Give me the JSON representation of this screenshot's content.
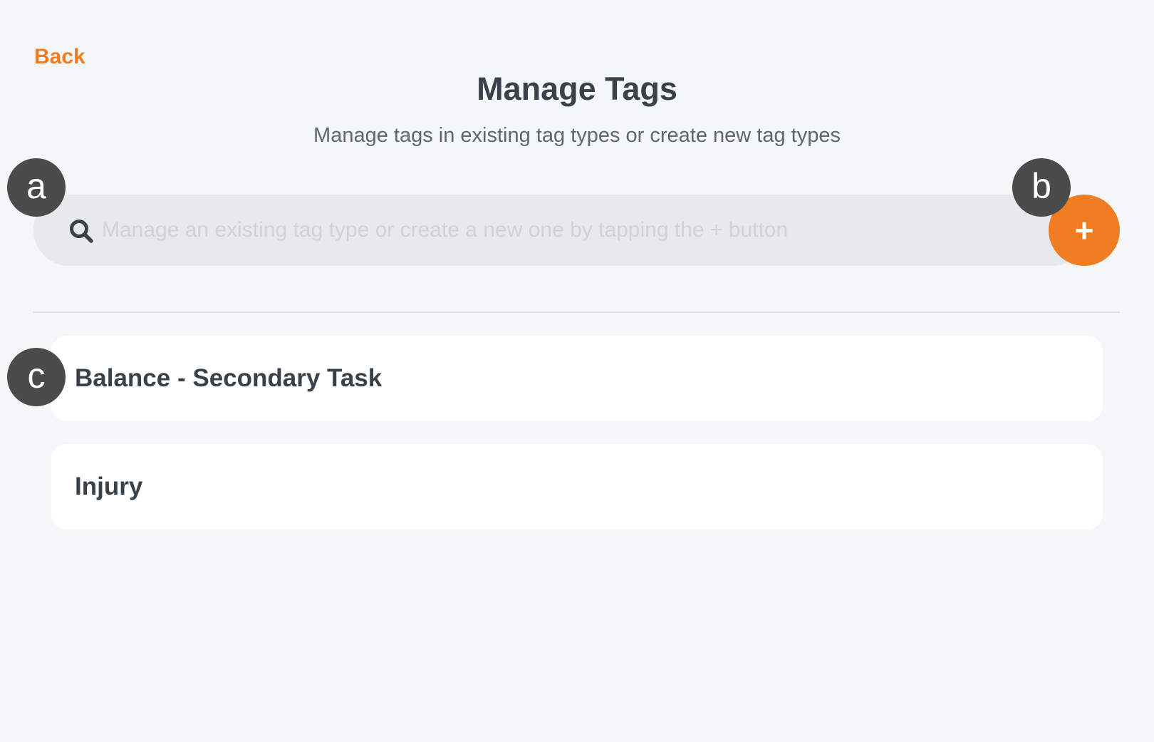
{
  "header": {
    "back_label": "Back",
    "title": "Manage Tags",
    "subtitle": "Manage tags in existing tag types or create new tag types"
  },
  "search": {
    "placeholder": "Manage an existing tag type or create a new one by tapping the + button",
    "value": "",
    "icon": "search-icon"
  },
  "add_button": {
    "label": "+",
    "icon": "plus-icon"
  },
  "tag_types": [
    {
      "label": "Balance - Secondary Task"
    },
    {
      "label": "Injury"
    }
  ],
  "annotations": {
    "a": "a",
    "b": "b",
    "c": "c"
  },
  "colors": {
    "accent": "#f07d22",
    "background": "#f4f6f8",
    "search_background": "#e7e9ec",
    "card_background": "#ffffff",
    "text": "#39424b",
    "marker": "#4b4b4b"
  }
}
